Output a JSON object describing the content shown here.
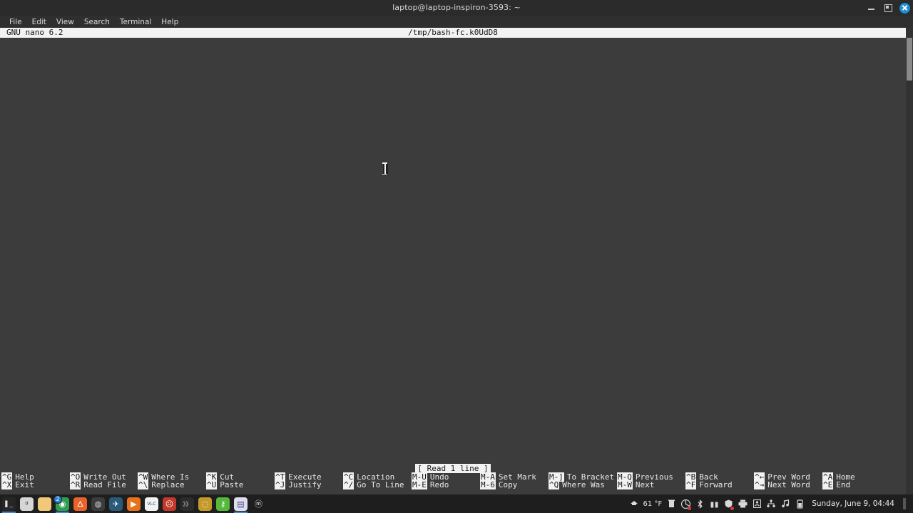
{
  "window": {
    "title": "laptop@laptop-inspiron-3593: ~",
    "controls": {
      "minimize": "minimize",
      "maximize": "maximize",
      "close": "close"
    }
  },
  "menubar": {
    "items": [
      {
        "label": "File"
      },
      {
        "label": "Edit"
      },
      {
        "label": "View"
      },
      {
        "label": "Search"
      },
      {
        "label": "Terminal"
      },
      {
        "label": "Help"
      }
    ]
  },
  "nano": {
    "version": "GNU nano 6.2",
    "filename": "/tmp/bash-fc.k0UdD8",
    "status": "[ Read 1 line ]",
    "buffer": "",
    "shortcuts": [
      {
        "key": "^G",
        "label": "Help",
        "key2": "^X",
        "label2": "Exit"
      },
      {
        "key": "^O",
        "label": "Write Out",
        "key2": "^R",
        "label2": "Read File"
      },
      {
        "key": "^W",
        "label": "Where Is",
        "key2": "^\\",
        "label2": "Replace"
      },
      {
        "key": "^K",
        "label": "Cut",
        "key2": "^U",
        "label2": "Paste"
      },
      {
        "key": "^T",
        "label": "Execute",
        "key2": "^J",
        "label2": "Justify"
      },
      {
        "key": "^C",
        "label": "Location",
        "key2": "^/",
        "label2": "Go To Line"
      },
      {
        "key": "M-U",
        "label": "Undo",
        "key2": "M-E",
        "label2": "Redo"
      },
      {
        "key": "M-A",
        "label": "Set Mark",
        "key2": "M-6",
        "label2": "Copy"
      },
      {
        "key": "M-]",
        "label": "To Bracket",
        "key2": "^Q",
        "label2": "Where Was"
      },
      {
        "key": "M-Q",
        "label": "Previous",
        "key2": "M-W",
        "label2": "Next"
      },
      {
        "key": "^B",
        "label": "Back",
        "key2": "^F",
        "label2": "Forward"
      },
      {
        "key": "^←",
        "label": "Prev Word",
        "key2": "^→",
        "label2": "Next Word"
      },
      {
        "key": "^A",
        "label": "Home",
        "key2": "^E",
        "label2": "End"
      }
    ]
  },
  "taskbar": {
    "launchers": [
      {
        "name": "terminal",
        "glyph": "▌_",
        "bg": "#262626",
        "fg": "#e0e0e0",
        "active": true,
        "badge": ""
      },
      {
        "name": "mate-app",
        "glyph": "ᵍ",
        "bg": "#d6d6d6",
        "fg": "#3a3a3a",
        "active": false,
        "badge": ""
      },
      {
        "name": "file-manager",
        "glyph": "",
        "bg": "#f0c877",
        "fg": "#7a5d1c",
        "active": false,
        "badge": ""
      },
      {
        "name": "google-chrome",
        "glyph": "◉",
        "bg": "#2f9e52",
        "fg": "#ffffff",
        "active": true,
        "badge": "2"
      },
      {
        "name": "firefox",
        "glyph": "🜂",
        "bg": "#e8622a",
        "fg": "#ffffff",
        "active": false,
        "badge": ""
      },
      {
        "name": "obs-studio",
        "glyph": "◍",
        "bg": "#3b3b3b",
        "fg": "#dadada",
        "active": false,
        "badge": ""
      },
      {
        "name": "steam",
        "glyph": "✈",
        "bg": "#2a5a78",
        "fg": "#ffffff",
        "active": false,
        "badge": ""
      },
      {
        "name": "media-player",
        "glyph": "▶",
        "bg": "#e8731a",
        "fg": "#ffffff",
        "active": false,
        "badge": ""
      },
      {
        "name": "vlc",
        "glyph": "VLC",
        "bg": "#f2f2f2",
        "fg": "#2a4d7a",
        "active": false,
        "badge": ""
      },
      {
        "name": "red-app",
        "glyph": "☹",
        "bg": "#c0392b",
        "fg": "#ffffff",
        "active": false,
        "badge": ""
      },
      {
        "name": "video-editor",
        "glyph": "》》",
        "bg": "#2c2c2c",
        "fg": "#cfcfcf",
        "active": false,
        "badge": ""
      },
      {
        "name": "screen-recorder",
        "glyph": "◌",
        "bg": "#c49a2a",
        "fg": "#ffffff",
        "active": false,
        "badge": ""
      },
      {
        "name": "key-app",
        "glyph": "⚷",
        "bg": "#55b83a",
        "fg": "#ffffff",
        "active": false,
        "badge": ""
      },
      {
        "name": "purple-app",
        "glyph": "▤",
        "bg": "#ddddf0",
        "fg": "#4a4a7a",
        "active": true,
        "badge": ""
      },
      {
        "name": "linux-mint",
        "glyph": "ⓜ",
        "bg": "#1e1e1e",
        "fg": "#e6e6e6",
        "active": false,
        "badge": ""
      }
    ],
    "tray": {
      "weather": "61 °F",
      "icons": [
        {
          "name": "weather-cloud-icon",
          "glyph": "☁",
          "dot": false
        },
        {
          "name": "trash-icon",
          "glyph": "🗑",
          "dot": false
        },
        {
          "name": "update-manager-icon",
          "glyph": "◍",
          "dot": true
        },
        {
          "name": "bluetooth-icon",
          "glyph": "✢",
          "dot": false
        },
        {
          "name": "gift-icon",
          "glyph": "🎁",
          "dot": false
        },
        {
          "name": "shield-icon",
          "glyph": "⛊",
          "dot": true
        },
        {
          "name": "printer-icon",
          "glyph": "⎙",
          "dot": false
        },
        {
          "name": "display-icon",
          "glyph": "▣",
          "dot": false
        },
        {
          "name": "network-icon",
          "glyph": "⛓",
          "dot": false
        },
        {
          "name": "volume-icon",
          "glyph": "♫",
          "dot": false
        },
        {
          "name": "battery-icon",
          "glyph": "▯",
          "dot": false
        }
      ],
      "clock": "Sunday, June 9, 04:44"
    }
  }
}
